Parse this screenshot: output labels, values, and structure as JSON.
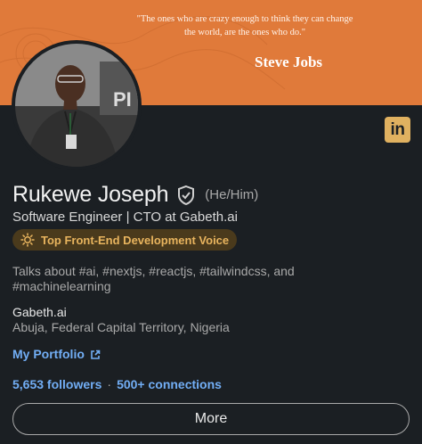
{
  "banner": {
    "quote": "\"The ones who are crazy enough to think they can change the world, are the ones who do.\"",
    "author": "Steve Jobs",
    "background_color": "#e07a3a"
  },
  "profile": {
    "avatar_icon": "profile-photo",
    "linkedin_badge": "in",
    "name": "Rukewe Joseph",
    "verified_icon": "verified-shield-icon",
    "pronouns": "(He/Him)",
    "headline": "Software Engineer | CTO at Gabeth.ai",
    "voice_badge": {
      "icon": "sun-icon",
      "label": "Top Front-End Development Voice",
      "color": "#e8b45e"
    },
    "about": "Talks about #ai, #nextjs, #reactjs, #tailwindcss, and #machinelearning",
    "company": "Gabeth.ai",
    "location": "Abuja, Federal Capital Territory, Nigeria",
    "portfolio_label": "My Portfolio",
    "followers": "5,653 followers",
    "separator": "·",
    "connections": "500+ connections",
    "link_color": "#72aef5"
  },
  "actions": {
    "more_label": "More"
  }
}
